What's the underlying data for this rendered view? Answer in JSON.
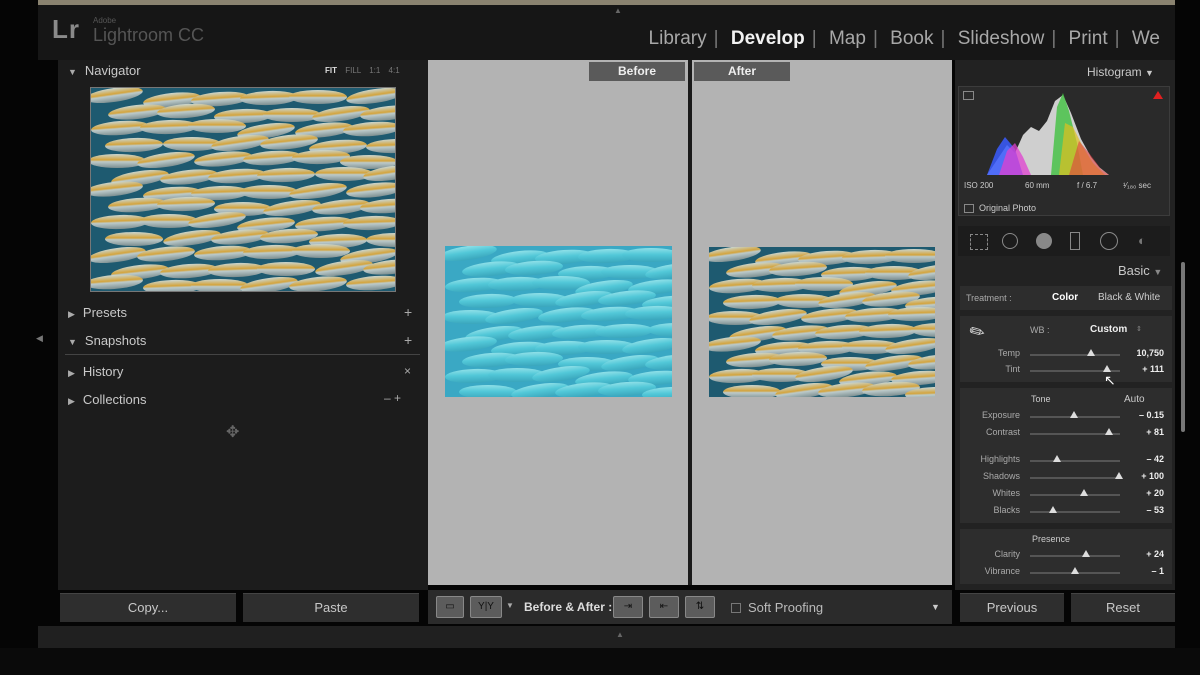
{
  "app": {
    "logo": "Lr",
    "vendor": "Adobe",
    "name": "Lightroom CC"
  },
  "modules": [
    "Library",
    "Develop",
    "Map",
    "Book",
    "Slideshow",
    "Print",
    "We"
  ],
  "active_module": "Develop",
  "left_panel": {
    "navigator": {
      "title": "Navigator",
      "zoom": [
        "FIT",
        "FILL",
        "1:1",
        "4:1"
      ]
    },
    "sections": [
      {
        "title": "Presets",
        "action": "+"
      },
      {
        "title": "Snapshots",
        "action": "+"
      },
      {
        "title": "History",
        "action": "×"
      },
      {
        "title": "Collections",
        "action": "– +"
      }
    ],
    "copy_button": "Copy...",
    "paste_button": "Paste"
  },
  "center": {
    "before_label": "Before",
    "after_label": "After"
  },
  "toolbar": {
    "view_label": "Y|Y",
    "before_after_label": "Before & After :",
    "soft_proofing": "Soft Proofing"
  },
  "right_panel": {
    "histogram": {
      "title": "Histogram",
      "iso": "ISO 200",
      "focal": "60 mm",
      "aperture": "f / 6.7",
      "shutter": "¹⁄₁₈₀ sec",
      "original_photo": "Original Photo"
    },
    "basic": {
      "title": "Basic",
      "treatment_label": "Treatment :",
      "treatment_color": "Color",
      "treatment_bw": "Black & White",
      "wb_label": "WB :",
      "wb_value": "Custom",
      "temp": {
        "label": "Temp",
        "value": "10,750",
        "position": 0.68
      },
      "tint": {
        "label": "Tint",
        "value": "+ 111",
        "position": 0.86
      },
      "tone_label": "Tone",
      "auto_label": "Auto",
      "tone": [
        {
          "label": "Exposure",
          "value": "– 0.15",
          "position": 0.49
        },
        {
          "label": "Contrast",
          "value": "+ 81",
          "position": 0.88
        },
        {
          "label": "Highlights",
          "value": "– 42",
          "position": 0.3
        },
        {
          "label": "Shadows",
          "value": "+ 100",
          "position": 0.99
        },
        {
          "label": "Whites",
          "value": "+ 20",
          "position": 0.6
        },
        {
          "label": "Blacks",
          "value": "– 53",
          "position": 0.25
        }
      ],
      "presence_label": "Presence",
      "presence": [
        {
          "label": "Clarity",
          "value": "+ 24",
          "position": 0.62
        },
        {
          "label": "Vibrance",
          "value": "– 1",
          "position": 0.5
        }
      ]
    },
    "previous_button": "Previous",
    "reset_button": "Reset"
  }
}
